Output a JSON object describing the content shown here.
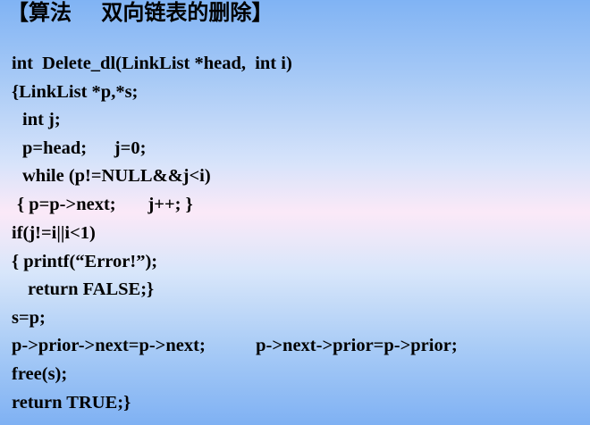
{
  "title": "【算法    双向链表的删除】",
  "code": [
    "int  Delete_dl(LinkList *head,  int i)",
    "{LinkList *p,*s;",
    "int j;",
    "p=head;      j=0;",
    "while (p!=NULL&&j<i)",
    "{ p=p->next;       j++; }",
    "if(j!=i||i<1)",
    "{ printf(“Error!”);",
    "return FALSE;}",
    "s=p;",
    "p->prior->next=p->next;           p->next->prior=p->prior;",
    "free(s);",
    "return TRUE;}"
  ]
}
